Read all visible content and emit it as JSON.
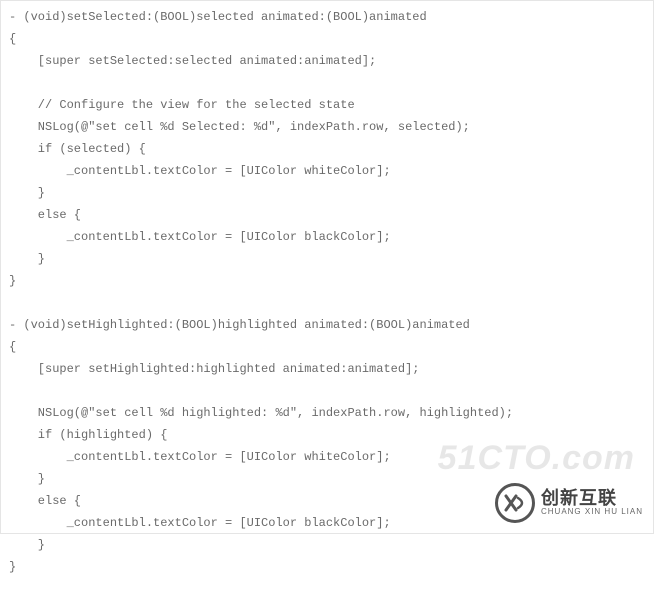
{
  "code": {
    "lines": [
      "- (void)setSelected:(BOOL)selected animated:(BOOL)animated",
      "{",
      "    [super setSelected:selected animated:animated];",
      "",
      "    // Configure the view for the selected state",
      "    NSLog(@\"set cell %d Selected: %d\", indexPath.row, selected);",
      "    if (selected) {",
      "        _contentLbl.textColor = [UIColor whiteColor];",
      "    }",
      "    else {",
      "        _contentLbl.textColor = [UIColor blackColor];",
      "    }",
      "}",
      "",
      "- (void)setHighlighted:(BOOL)highlighted animated:(BOOL)animated",
      "{",
      "    [super setHighlighted:highlighted animated:animated];",
      "",
      "    NSLog(@\"set cell %d highlighted: %d\", indexPath.row, highlighted);",
      "    if (highlighted) {",
      "        _contentLbl.textColor = [UIColor whiteColor];",
      "    }",
      "    else {",
      "        _contentLbl.textColor = [UIColor blackColor];",
      "    }",
      "}"
    ]
  },
  "watermark": {
    "faded": "51CTO.com",
    "brand_cn": "创新互联",
    "brand_en": "CHUANG XIN HU LIAN"
  }
}
